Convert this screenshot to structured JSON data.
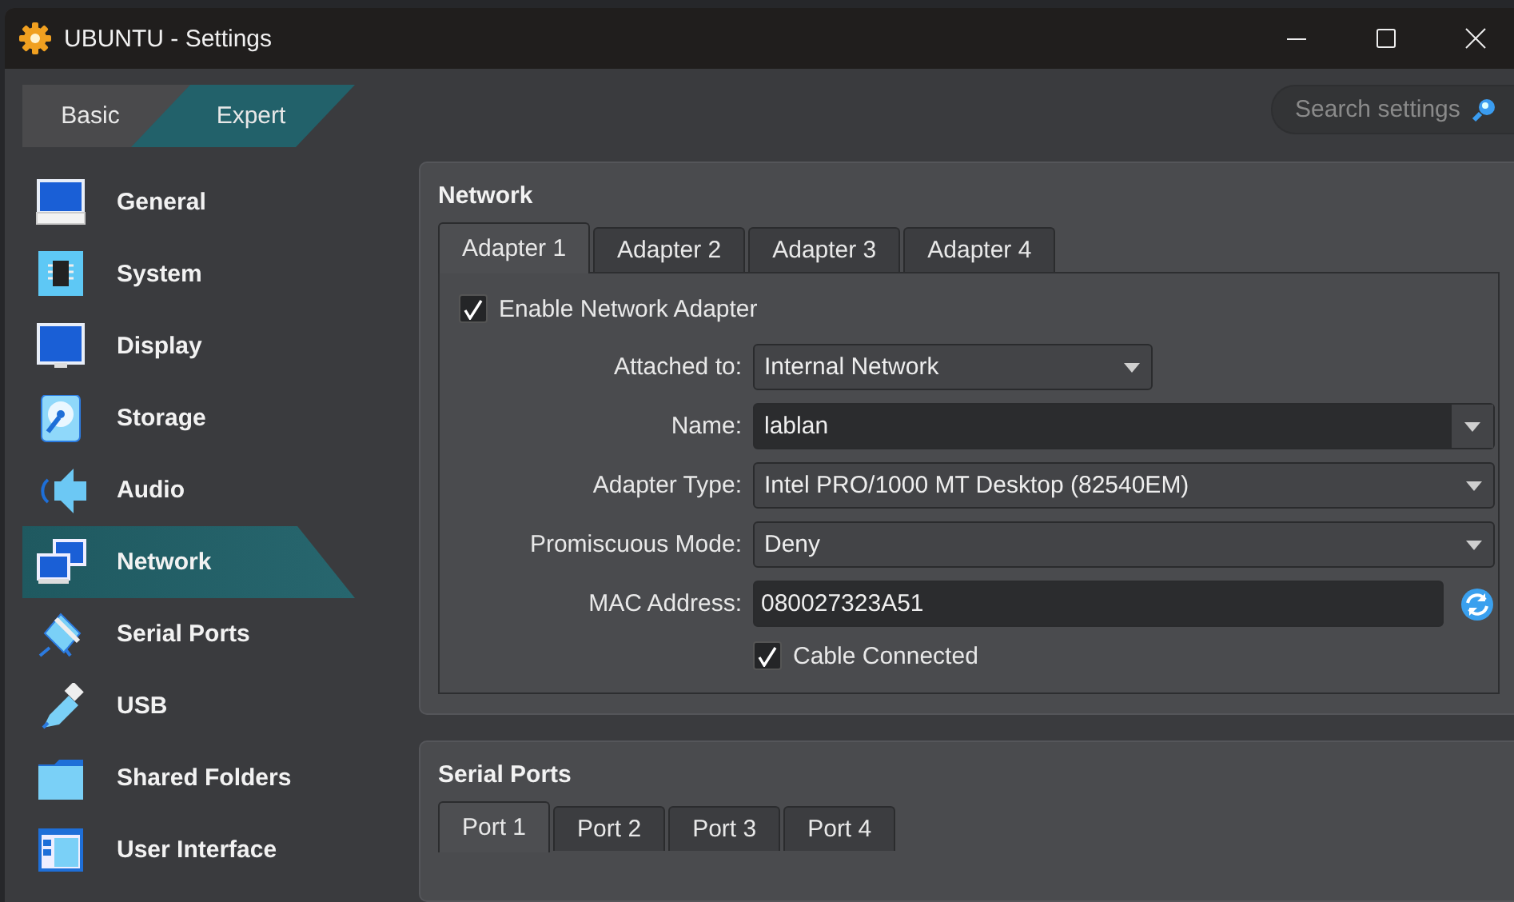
{
  "window": {
    "title": "UBUNTU - Settings"
  },
  "mode_switch": [
    {
      "label": "Basic",
      "selected": false
    },
    {
      "label": "Expert",
      "selected": true
    }
  ],
  "search": {
    "placeholder": "Search settings"
  },
  "sidebar": {
    "items": [
      {
        "label": "General",
        "kind": "general",
        "selected": false
      },
      {
        "label": "System",
        "kind": "system",
        "selected": false
      },
      {
        "label": "Display",
        "kind": "display",
        "selected": false
      },
      {
        "label": "Storage",
        "kind": "storage",
        "selected": false
      },
      {
        "label": "Audio",
        "kind": "audio",
        "selected": false
      },
      {
        "label": "Network",
        "kind": "network",
        "selected": true
      },
      {
        "label": "Serial Ports",
        "kind": "serial",
        "selected": false
      },
      {
        "label": "USB",
        "kind": "usb",
        "selected": false
      },
      {
        "label": "Shared Folders",
        "kind": "folders",
        "selected": false
      },
      {
        "label": "User Interface",
        "kind": "ui",
        "selected": false
      }
    ]
  },
  "network": {
    "title": "Network",
    "tabs": [
      {
        "label": "Adapter 1",
        "selected": true
      },
      {
        "label": "Adapter 2",
        "selected": false
      },
      {
        "label": "Adapter 3",
        "selected": false
      },
      {
        "label": "Adapter 4",
        "selected": false
      }
    ],
    "enable_adapter": {
      "label": "Enable Network Adapter",
      "checked": true
    },
    "fields": [
      {
        "kind": "short_combo",
        "label": "Attached to:",
        "value": "Internal Network"
      },
      {
        "kind": "editable_combo",
        "label": "Name:",
        "value": "lablan"
      },
      {
        "kind": "combo",
        "label": "Adapter Type:",
        "value": "Intel PRO/1000 MT Desktop (82540EM)"
      },
      {
        "kind": "combo",
        "label": "Promiscuous Mode:",
        "value": "Deny"
      },
      {
        "kind": "mac",
        "label": "MAC Address:",
        "value": "080027323A51"
      }
    ],
    "cable_connected": {
      "label": "Cable Connected",
      "checked": true
    }
  },
  "serial_ports": {
    "title": "Serial Ports",
    "tabs": [
      {
        "label": "Port 1",
        "selected": true
      },
      {
        "label": "Port 2",
        "selected": false
      },
      {
        "label": "Port 3",
        "selected": false
      },
      {
        "label": "Port 4",
        "selected": false
      }
    ]
  }
}
